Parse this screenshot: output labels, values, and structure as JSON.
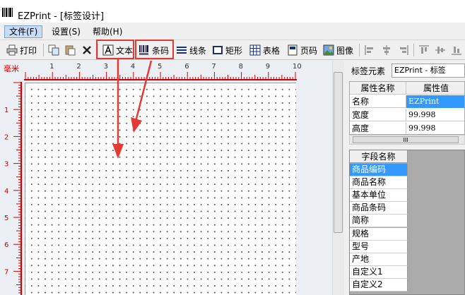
{
  "window": {
    "title": "EZPrint - [标签设计]"
  },
  "menu": [
    {
      "label": "文件(F)",
      "active": true
    },
    {
      "label": "设置(S)",
      "active": false
    },
    {
      "label": "帮助(H)",
      "active": false
    }
  ],
  "toolbar": {
    "print": "打印",
    "text": "文本",
    "barcode": "条码",
    "line": "线条",
    "rect": "矩形",
    "table": "表格",
    "page_number": "页码",
    "image": "图像"
  },
  "ruler": {
    "unit": "毫米",
    "h_ticks": [
      "1",
      "2",
      "3",
      "4",
      "5",
      "6",
      "7",
      "8",
      "9",
      "10"
    ],
    "v_ticks": [
      "1",
      "2",
      "3",
      "4",
      "5",
      "6",
      "7"
    ]
  },
  "panel": {
    "element_label": "标签元素",
    "element_value": "EZPrint - 标签",
    "prop_headers": [
      "属性名称",
      "属性值"
    ],
    "props": [
      {
        "name": "名称",
        "value": "EZPrint"
      },
      {
        "name": "宽度",
        "value": "99.998"
      },
      {
        "name": "高度",
        "value": "99.998"
      }
    ],
    "scroll_glyph": "III",
    "field_header": "字段名称",
    "fields": [
      "商品编码",
      "商品名称",
      "基本单位",
      "商品条码",
      "简称",
      "规格",
      "型号",
      "产地",
      "自定义1",
      "自定义2"
    ]
  },
  "colors": {
    "annotation": "#e53935",
    "selection": "#3399ff",
    "ruler_accent": "#d40000"
  }
}
